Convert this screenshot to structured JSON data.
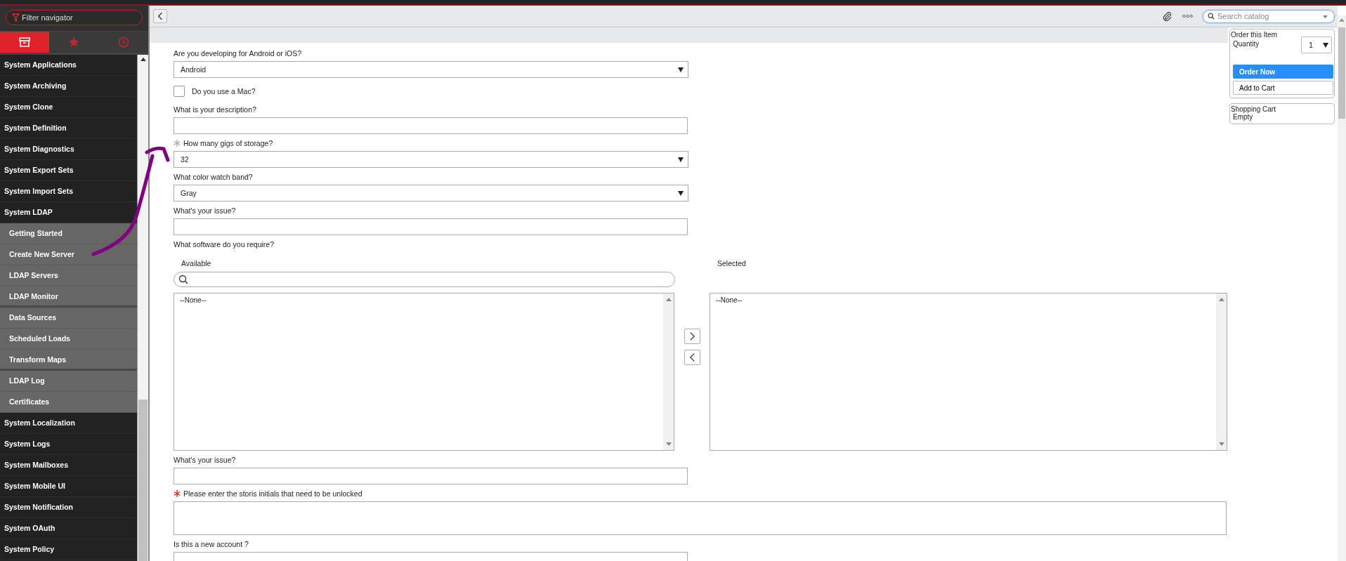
{
  "sidebar": {
    "filter": {
      "placeholder": "Filter navigator"
    },
    "tabs": [
      {
        "kind": "all",
        "selected": true
      },
      {
        "kind": "favorites",
        "selected": false
      },
      {
        "kind": "history",
        "selected": false
      }
    ],
    "items": [
      {
        "label": "System Applications"
      },
      {
        "label": "System Archiving"
      },
      {
        "label": "System Clone"
      },
      {
        "label": "System Definition"
      },
      {
        "label": "System Diagnostics"
      },
      {
        "label": "System Export Sets"
      },
      {
        "label": "System Import Sets"
      },
      {
        "label": "System LDAP",
        "children": [
          {
            "label": "Getting Started",
            "divider_after": false
          },
          {
            "label": "Create New Server",
            "divider_after": false
          },
          {
            "label": "LDAP Servers",
            "divider_after": false
          },
          {
            "label": "LDAP Monitor",
            "divider_after": true
          },
          {
            "label": "Data Sources",
            "divider_after": false
          },
          {
            "label": "Scheduled Loads",
            "divider_after": false
          },
          {
            "label": "Transform Maps",
            "divider_after": true
          },
          {
            "label": "LDAP Log",
            "divider_after": false
          },
          {
            "label": "Certificates",
            "divider_after": false
          }
        ]
      },
      {
        "label": "System Localization"
      },
      {
        "label": "System Logs"
      },
      {
        "label": "System Mailboxes"
      },
      {
        "label": "System Mobile UI"
      },
      {
        "label": "System Notification"
      },
      {
        "label": "System OAuth"
      },
      {
        "label": "System Policy"
      }
    ]
  },
  "header": {
    "search": {
      "placeholder": "Search catalog"
    }
  },
  "form": {
    "questions": [
      {
        "kind": "select",
        "label": "Are you developing for Android or iOS?",
        "value": "Android"
      },
      {
        "kind": "checkbox",
        "label": "Do you use a Mac?",
        "checked": false
      },
      {
        "kind": "text",
        "label": "What is your description?"
      },
      {
        "kind": "select",
        "label": "How many gigs of storage?",
        "value": "32",
        "mandatory": true,
        "satisfied": true
      },
      {
        "kind": "select",
        "label": "What color watch band?",
        "value": "Gray"
      },
      {
        "kind": "text",
        "label": "What's your issue?"
      },
      {
        "kind": "slushbucket",
        "label": "What software do you require?",
        "available_title": "Available",
        "selected_title": "Selected",
        "available_items": [
          "--None--"
        ],
        "selected_items": [
          "--None--"
        ]
      },
      {
        "kind": "text",
        "label": "What's your issue?"
      },
      {
        "kind": "textarea",
        "label": "Please enter the storis initials that need to be unlocked",
        "mandatory": true,
        "satisfied": false
      },
      {
        "kind": "text",
        "label": "Is this a new account ?"
      }
    ]
  },
  "order": {
    "title": "Order this Item",
    "quantity_label": "Quantity",
    "quantity": "1",
    "buttons": [
      {
        "label": "Order Now",
        "kind": "primary"
      },
      {
        "label": "Add to Cart",
        "kind": "default"
      }
    ]
  },
  "cart": {
    "title": "Shopping Cart",
    "status": "Empty"
  }
}
